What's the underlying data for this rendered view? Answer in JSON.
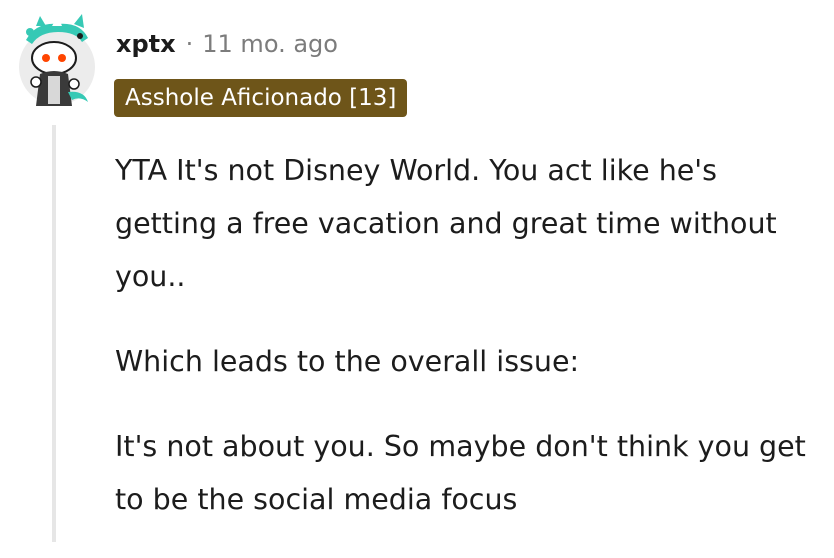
{
  "comment": {
    "author": "xptx",
    "separator": "·",
    "time": "11 mo. ago",
    "flair": "Asshole Aficionado [13]",
    "paragraphs": [
      "YTA It's not Disney World. You act like he's getting a free vacation and great time without you..",
      "Which leads to the overall issue:",
      "It's not about you. So maybe don't think you get to be the social media focus"
    ]
  },
  "colors": {
    "flair_bg": "#6e5519",
    "flair_text": "#ffffff",
    "muted_text": "#7c7c7c",
    "thread_line": "#e6e6e6"
  }
}
